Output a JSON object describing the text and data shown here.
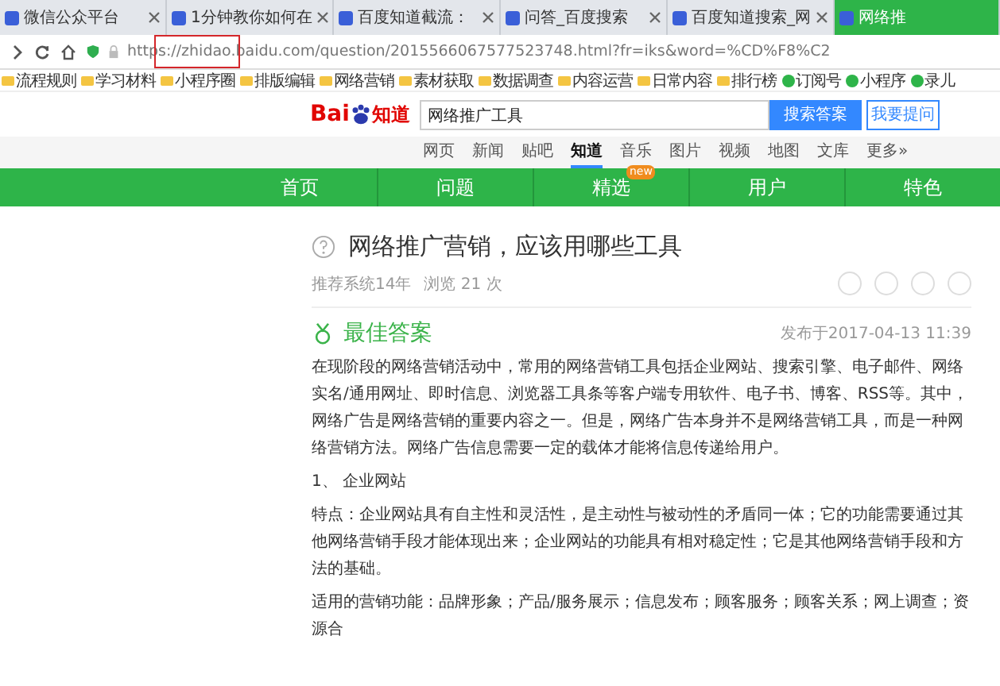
{
  "browser_tabs": [
    {
      "title": "微信公众平台",
      "selected": false
    },
    {
      "title": "1分钟教你如何在",
      "selected": false
    },
    {
      "title": "百度知道截流：",
      "selected": false
    },
    {
      "title": "问答_百度搜索",
      "selected": false
    },
    {
      "title": "百度知道搜索_网",
      "selected": false
    },
    {
      "title": "网络推",
      "selected": true
    }
  ],
  "address_bar": {
    "url": "https://zhidao.baidu.com/question/2015566067577523748.html?fr=iks&word=%CD%F8%C2"
  },
  "bookmarks": [
    {
      "label": "流程规则",
      "kind": "folder"
    },
    {
      "label": "学习材料",
      "kind": "folder"
    },
    {
      "label": "小程序圈",
      "kind": "folder"
    },
    {
      "label": "排版编辑",
      "kind": "folder"
    },
    {
      "label": "网络营销",
      "kind": "folder"
    },
    {
      "label": "素材获取",
      "kind": "folder"
    },
    {
      "label": "数据调查",
      "kind": "folder"
    },
    {
      "label": "内容运营",
      "kind": "folder"
    },
    {
      "label": "日常内容",
      "kind": "folder"
    },
    {
      "label": "排行榜",
      "kind": "folder"
    },
    {
      "label": "订阅号",
      "kind": "app"
    },
    {
      "label": "小程序",
      "kind": "app"
    },
    {
      "label": "录儿",
      "kind": "app"
    }
  ],
  "header": {
    "logo_text": "Bai",
    "logo_suffix": "知道",
    "search_value": "网络推广工具",
    "search_button": "搜索答案",
    "ask_button": "我要提问"
  },
  "subnav": [
    {
      "label": "网页",
      "selected": false
    },
    {
      "label": "新闻",
      "selected": false
    },
    {
      "label": "贴吧",
      "selected": false
    },
    {
      "label": "知道",
      "selected": true
    },
    {
      "label": "音乐",
      "selected": false
    },
    {
      "label": "图片",
      "selected": false
    },
    {
      "label": "视频",
      "selected": false
    },
    {
      "label": "地图",
      "selected": false
    },
    {
      "label": "文库",
      "selected": false
    },
    {
      "label": "更多»",
      "selected": false
    }
  ],
  "main_nav": [
    {
      "label": "首页"
    },
    {
      "label": "问题"
    },
    {
      "label": "精选",
      "badge": "new"
    },
    {
      "label": "用户"
    },
    {
      "label": "特色"
    }
  ],
  "question": {
    "title": "网络推广营销，应该用哪些工具",
    "meta": [
      "推荐系统14年",
      "浏览 21 次"
    ]
  },
  "answer": {
    "heading": "最佳答案",
    "date": "发布于2017-04-13 11:39",
    "paragraphs": [
      "在现阶段的网络营销活动中，常用的网络营销工具包括企业网站、搜索引擎、电子邮件、网络实名/通用网址、即时信息、浏览器工具条等客户端专用软件、电子书、博客、RSS等。其中，网络广告是网络营销的重要内容之一。但是，网络广告本身并不是网络营销工具，而是一种网络营销方法。网络广告信息需要一定的载体才能将信息传递给用户。",
      "1、 企业网站",
      "特点：企业网站具有自主性和灵活性，是主动性与被动性的矛盾同一体；它的功能需要通过其他网络营销手段才能体现出来；企业网站的功能具有相对稳定性；它是其他网络营销手段和方法的基础。",
      "适用的营销功能：品牌形象；产品/服务展示；信息发布；顾客服务；顾客关系；网上调查；资源合"
    ]
  }
}
